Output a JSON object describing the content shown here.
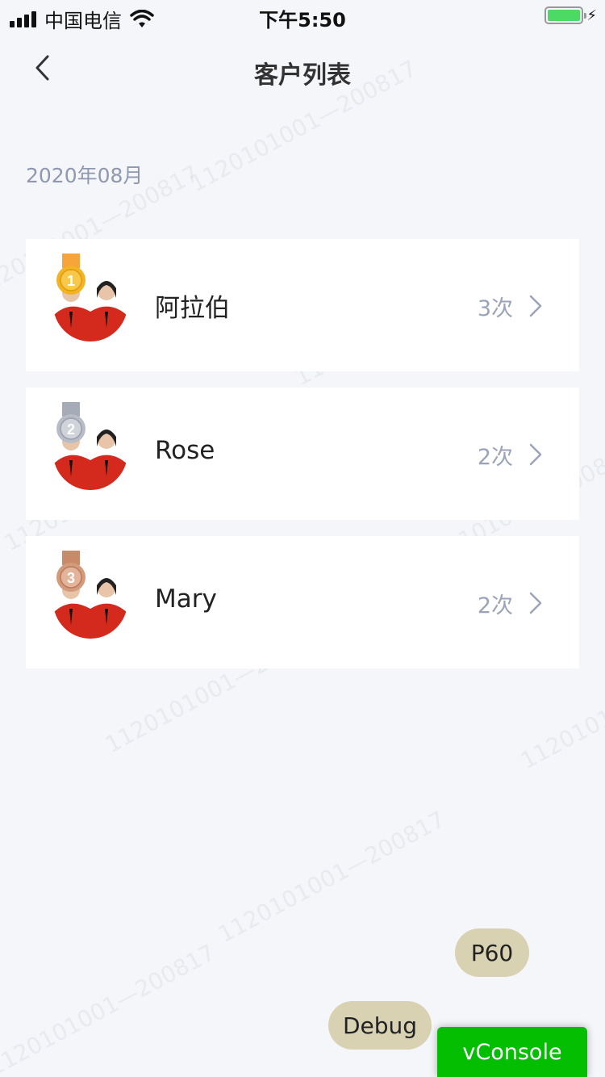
{
  "status_bar": {
    "carrier": "中国电信",
    "time": "下午5:50"
  },
  "nav": {
    "title": "客户列表"
  },
  "month": "2020年08月",
  "customers": [
    {
      "rank": "1",
      "name": "阿拉伯",
      "count": "3次",
      "medal_color": "#f0b429"
    },
    {
      "rank": "2",
      "name": "Rose",
      "count": "2次",
      "medal_color": "#b8bcc6"
    },
    {
      "rank": "3",
      "name": "Mary",
      "count": "2次",
      "medal_color": "#d49a7c"
    }
  ],
  "watermark_text": "1120101001—200817",
  "debug": {
    "p60": "P60",
    "debug": "Debug",
    "vconsole": "vConsole"
  },
  "colors": {
    "background": "#f5f6fa",
    "secondary_text": "#8e98b0",
    "vconsole_green": "#04be02",
    "battery_green": "#4cd964"
  }
}
